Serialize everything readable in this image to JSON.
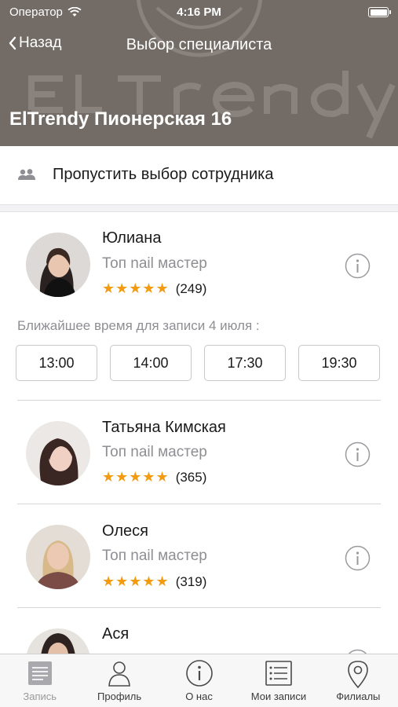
{
  "status_bar": {
    "carrier": "Оператор",
    "time": "4:16 PM"
  },
  "nav": {
    "back_label": "Назад",
    "title": "Выбор специалиста"
  },
  "branch": {
    "name": "ElTrendy Пионерская 16"
  },
  "skip": {
    "label": "Пропустить выбор сотрудника"
  },
  "specialists": [
    {
      "name": "Юлиана",
      "role": "Топ nail мастер",
      "stars": "★★★★★",
      "reviews": "(249)",
      "nearest_label": "Ближайшее время для записи 4 июля :",
      "slots": [
        "13:00",
        "14:00",
        "17:30",
        "19:30"
      ]
    },
    {
      "name": "Татьяна Кимская",
      "role": "Топ nail мастер",
      "stars": "★★★★★",
      "reviews": "(365)"
    },
    {
      "name": "Олеся",
      "role": "Топ nail мастер",
      "stars": "★★★★★",
      "reviews": "(319)"
    },
    {
      "name": "Ася"
    }
  ],
  "tab_bar": {
    "tabs": [
      {
        "label": "Запись",
        "icon": "booking-icon"
      },
      {
        "label": "Профиль",
        "icon": "profile-icon"
      },
      {
        "label": "О нас",
        "icon": "info-icon"
      },
      {
        "label": "Мои записи",
        "icon": "list-icon"
      },
      {
        "label": "Филиалы",
        "icon": "map-pin-icon"
      }
    ]
  },
  "colors": {
    "header_bg": "#736c66",
    "star": "#f29b11",
    "secondary_text": "#8e8e93",
    "divider": "#d6d6d8"
  }
}
